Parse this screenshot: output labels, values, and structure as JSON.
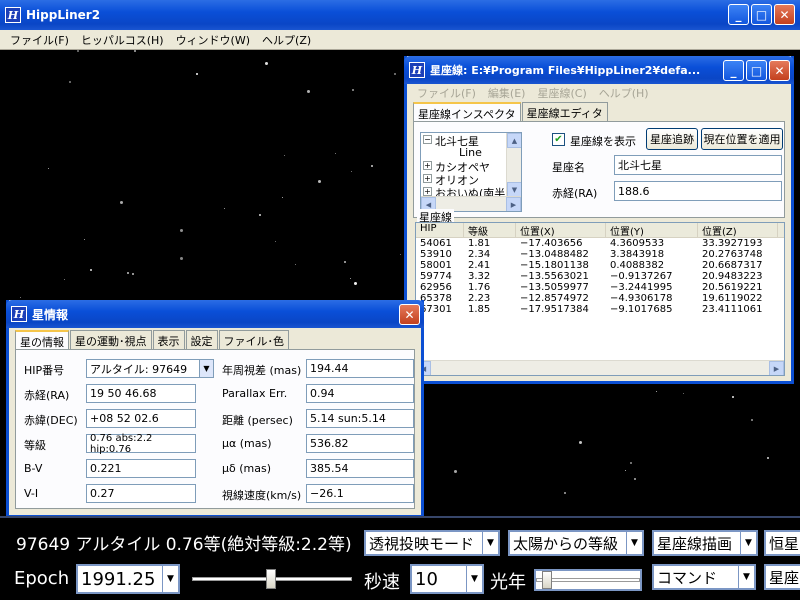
{
  "app": {
    "title": "HippLiner2",
    "icon_letter": "H",
    "menu": [
      "ファイル(F)",
      "ヒッパルコス(H)",
      "ウィンドウ(W)",
      "ヘルプ(Z)"
    ]
  },
  "caption_buttons": {
    "minimize": "_",
    "maximize": "□",
    "close": "✕"
  },
  "constellation_window": {
    "title": "星座線: E:¥Program Files¥HippLiner2¥defa...",
    "menu": [
      "ファイル(F)",
      "編集(E)",
      "星座線(C)",
      "ヘルプ(H)"
    ],
    "tabs": [
      "星座線インスペクタ",
      "星座線エディタ"
    ],
    "tree": [
      {
        "label": "北斗七星",
        "expander": "−",
        "child": false
      },
      {
        "label": "Line",
        "expander": "",
        "child": true
      },
      {
        "label": "カシオペヤ",
        "expander": "+",
        "child": false
      },
      {
        "label": "オリオン",
        "expander": "+",
        "child": false
      },
      {
        "label": "おおいぬ(南半)",
        "expander": "+",
        "child": false
      }
    ],
    "show_lines_label": "星座線を表示",
    "show_lines_checked": "✔",
    "track_button": "星座追跡",
    "apply_button": "現在位置を適用",
    "name_label": "星座名",
    "name_value": "北斗七星",
    "ra_label": "赤経(RA)",
    "ra_value": "188.6",
    "list_label": "星座線",
    "columns": [
      "HIP",
      "等級",
      "位置(X)",
      "位置(Y)",
      "位置(Z)"
    ],
    "rows": [
      [
        "54061",
        "1.81",
        "−17.403656",
        "4.3609533",
        "33.3927193"
      ],
      [
        "53910",
        "2.34",
        "−13.0488482",
        "3.3843918",
        "20.2763748"
      ],
      [
        "58001",
        "2.41",
        "−15.1801138",
        "0.4088382",
        "20.6687317"
      ],
      [
        "59774",
        "3.32",
        "−13.5563021",
        "−0.9137267",
        "20.9483223"
      ],
      [
        "62956",
        "1.76",
        "−13.5059977",
        "−3.2441995",
        "20.5619221"
      ],
      [
        "65378",
        "2.23",
        "−12.8574972",
        "−4.9306178",
        "19.6119022"
      ],
      [
        "67301",
        "1.85",
        "−17.9517384",
        "−9.1017685",
        "23.4111061"
      ]
    ]
  },
  "star_info_window": {
    "title": "星情報",
    "tabs": [
      "星の情報",
      "星の運動･視点",
      "表示",
      "設定",
      "ファイル･色"
    ],
    "left_fields": [
      {
        "label": "HIP番号",
        "value": "アルタイル:  97649"
      },
      {
        "label": "赤経(RA)",
        "value": "19 50 46.68"
      },
      {
        "label": "赤緯(DEC)",
        "value": "+08 52 02.6"
      },
      {
        "label": "等級",
        "value": "0.76 abs:2.2 hip:0.76"
      },
      {
        "label": "B-V",
        "value": "0.221"
      },
      {
        "label": "V-I",
        "value": "0.27"
      }
    ],
    "right_fields": [
      {
        "label": "年周視差 (mas)",
        "value": "194.44"
      },
      {
        "label": "Parallax Err.",
        "value": "0.94"
      },
      {
        "label": "距離 (persec)",
        "value": "5.14 sun:5.14"
      },
      {
        "label": "μα (mas)",
        "value": "536.82"
      },
      {
        "label": "μδ (mas)",
        "value": "385.54"
      },
      {
        "label": "視線速度(km/s)",
        "value": "−26.1"
      }
    ]
  },
  "bottom_bar": {
    "status": "97649 アルタイル 0.76等(絶対等級:2.2等)",
    "projection": "透視投映モード",
    "magnitude_mode": "太陽からの等級",
    "draw_lines": "星座線描画",
    "star_label_partial": "恒星",
    "epoch_label": "Epoch",
    "epoch_value": "1991.25",
    "speed_label": "秒速",
    "speed_value": "10",
    "lightyear_label": "光年",
    "command": "コマンド",
    "const_label_partial": "星座"
  }
}
